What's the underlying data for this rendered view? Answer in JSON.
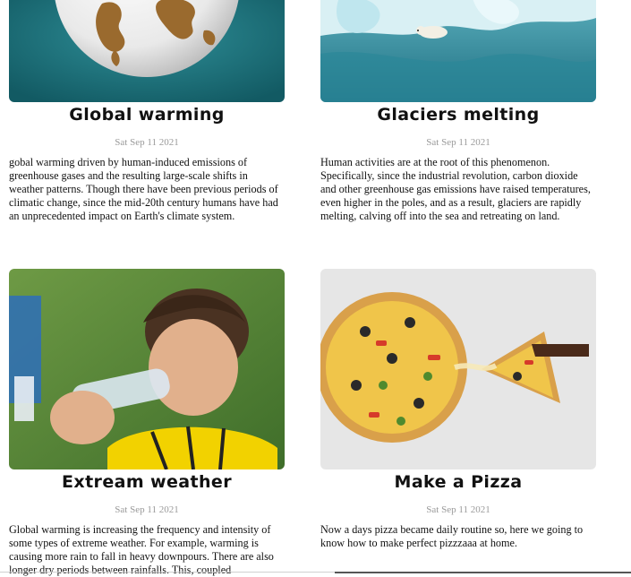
{
  "posts": [
    {
      "title": "Global warming",
      "date": "Sat Sep 11 2021",
      "body": "gobal warming driven by human-induced emissions of greenhouse gases and the resulting large-scale shifts in weather patterns. Though there have been previous periods of climatic change, since the mid-20th century humans have had an unprecedented impact on Earth's climate system.",
      "image_icon": "globe-image"
    },
    {
      "title": "Glaciers melting",
      "date": "Sat Sep 11 2021",
      "body": "Human activities are at the root of this phenomenon. Specifically, since the industrial revolution, carbon dioxide and other greenhouse gas emissions have raised temperatures, even higher in the poles, and as a result, glaciers are rapidly melting, calving off into the sea and retreating on land.",
      "image_icon": "polar-bear-ice-image"
    },
    {
      "title": "Extream weather",
      "date": "Sat Sep 11 2021",
      "body": "Global warming is increasing the frequency and intensity of some types of extreme weather. For example, warming is causing more rain to fall in heavy downpours. There are also longer dry periods between rainfalls. This, coupled",
      "image_icon": "boy-drinking-water-image"
    },
    {
      "title": "Make a Pizza",
      "date": "Sat Sep 11 2021",
      "body": "Now a days pizza became daily routine so, here we going to know how to make perfect pizzzaaa at home.",
      "image_icon": "pizza-image"
    }
  ],
  "colors": {
    "title": "#111111",
    "date": "#9a9a9a",
    "body": "#111111"
  }
}
